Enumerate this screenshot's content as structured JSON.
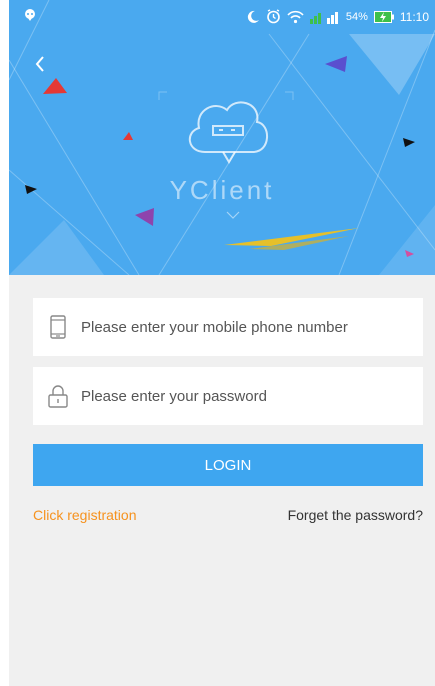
{
  "status_bar": {
    "battery_percent": "54%",
    "time": "11:10",
    "icons": [
      "chat-bubble-icon",
      "moon-icon",
      "alarm-icon",
      "wifi-icon",
      "signal-icon",
      "battery-charging-icon"
    ]
  },
  "header": {
    "brand": "YClient",
    "icons": [
      "back-chevron-icon",
      "cloud-device-logo"
    ]
  },
  "form": {
    "phone_placeholder": "Please enter your mobile phone number",
    "password_placeholder": "Please enter your password",
    "phone_icon": "phone-icon",
    "password_icon": "lock-icon"
  },
  "actions": {
    "login_label": "LOGIN",
    "register_label": "Click registration",
    "forgot_label": "Forget the password?"
  },
  "colors": {
    "header_bg": "#4aa9ef",
    "button_bg": "#3ea6f0",
    "register_link": "#f6921e",
    "page_bg": "#f0f0f0"
  }
}
